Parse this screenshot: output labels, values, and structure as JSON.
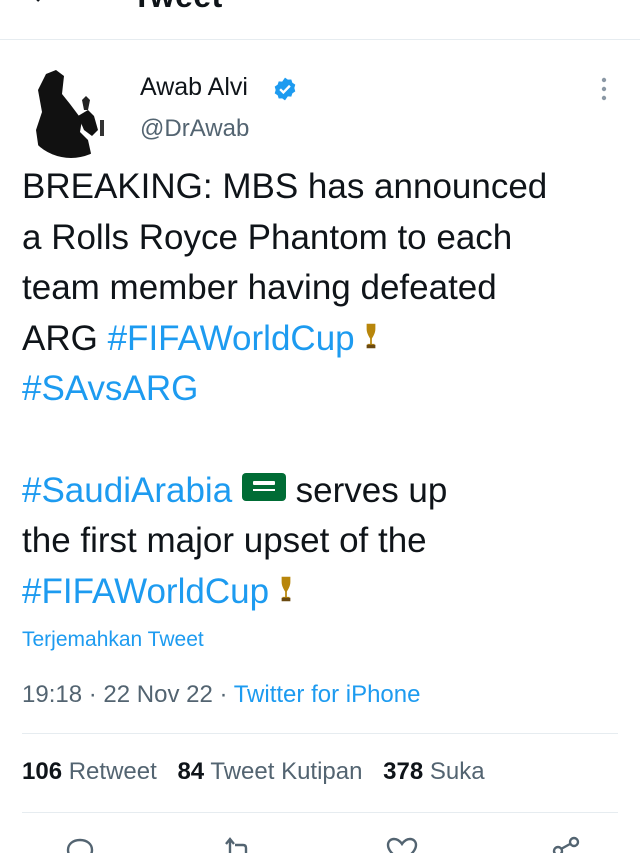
{
  "header": {
    "title": "Tweet"
  },
  "author": {
    "name": "Awab Alvi",
    "handle": "@DrAwab"
  },
  "tweet": {
    "lines": [
      "BREAKING: MBS has announced",
      "a Rolls Royce Phantom to each",
      "team member having defeated",
      "ARG",
      "#FIFAWorldCup",
      "#SAvsARG",
      "#SaudiArabia",
      "serves up",
      "the first major upset of the",
      "#FIFAWorldCup"
    ]
  },
  "translate_label": "Terjemahkan Tweet",
  "meta": {
    "time": "19:18",
    "date": "22 Nov 22",
    "separator": "·",
    "source": "Twitter for iPhone"
  },
  "stats": {
    "retweets_count": "106",
    "retweets_label": "Retweet",
    "quotes_count": "84",
    "quotes_label": "Tweet Kutipan",
    "likes_count": "378",
    "likes_label": "Suka"
  },
  "icons": {
    "back": "arrow-left-icon",
    "verified": "verified-badge-icon",
    "more": "more-vertical-icon",
    "trophy": "trophy-emoji",
    "flag": "saudi-flag-emoji",
    "reply": "reply-icon",
    "retweet": "retweet-icon",
    "like": "heart-icon",
    "share": "share-icon"
  },
  "colors": {
    "accent": "#1d9bf0",
    "text": "#0f1419",
    "secondary": "#536471",
    "divider": "#e6ecf0"
  }
}
